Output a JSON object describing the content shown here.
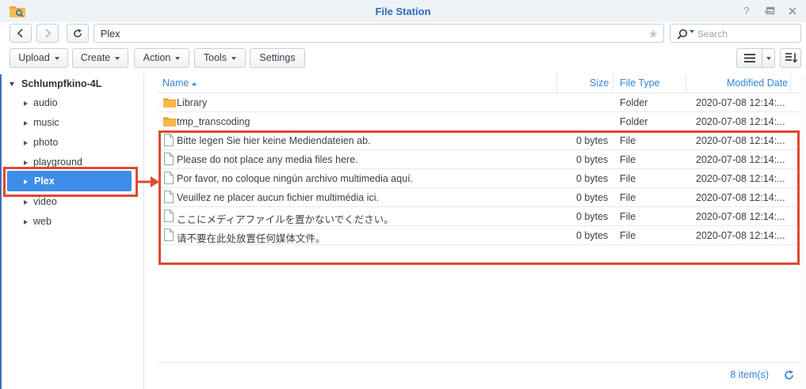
{
  "window": {
    "title": "File Station"
  },
  "toolbar": {
    "path": "Plex",
    "search_placeholder": "Search",
    "upload_label": "Upload",
    "create_label": "Create",
    "action_label": "Action",
    "tools_label": "Tools",
    "settings_label": "Settings"
  },
  "sidebar": {
    "root": "Schlumpfkino-4L",
    "items": [
      {
        "label": "audio"
      },
      {
        "label": "music"
      },
      {
        "label": "photo"
      },
      {
        "label": "playground"
      },
      {
        "label": "Plex"
      },
      {
        "label": "video"
      },
      {
        "label": "web"
      }
    ]
  },
  "table": {
    "columns": {
      "name": "Name",
      "size": "Size",
      "type": "File Type",
      "modified": "Modified Date"
    },
    "rows": [
      {
        "name": "Library",
        "size": "",
        "type": "Folder",
        "modified": "2020-07-08 12:14:...",
        "icon": "folder-icon"
      },
      {
        "name": "tmp_transcoding",
        "size": "",
        "type": "Folder",
        "modified": "2020-07-08 12:14:...",
        "icon": "folder-icon"
      },
      {
        "name": "Bitte legen Sie hier keine Mediendateien ab.",
        "size": "0 bytes",
        "type": "File",
        "modified": "2020-07-08 12:14:...",
        "icon": "file-icon"
      },
      {
        "name": "Please do not place any media files here.",
        "size": "0 bytes",
        "type": "File",
        "modified": "2020-07-08 12:14:...",
        "icon": "file-icon"
      },
      {
        "name": "Por favor, no coloque ningún archivo multimedia aquí.",
        "size": "0 bytes",
        "type": "File",
        "modified": "2020-07-08 12:14:...",
        "icon": "file-icon"
      },
      {
        "name": "Veuillez ne placer aucun fichier multimédia ici.",
        "size": "0 bytes",
        "type": "File",
        "modified": "2020-07-08 12:14:...",
        "icon": "file-icon"
      },
      {
        "name": "ここにメディアファイルを置かないでください。",
        "size": "0 bytes",
        "type": "File",
        "modified": "2020-07-08 12:14:...",
        "icon": "file-icon"
      },
      {
        "name": "请不要在此处放置任何媒体文件。",
        "size": "0 bytes",
        "type": "File",
        "modified": "2020-07-08 12:14:...",
        "icon": "file-icon"
      }
    ]
  },
  "footer": {
    "count": "8 item(s)"
  },
  "colors": {
    "accent": "#3586d8",
    "selection": "#3d8ee8",
    "highlight": "#e0482f",
    "folder": "#f2a93b"
  }
}
